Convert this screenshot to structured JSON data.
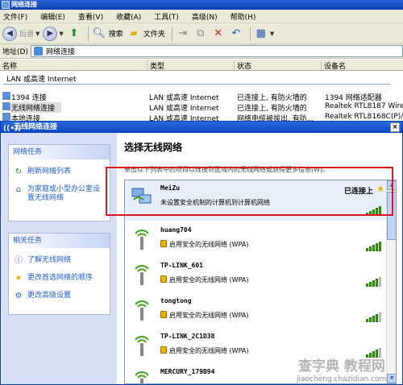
{
  "window": {
    "title": "网络连接"
  },
  "menubar": [
    "文件(F)",
    "编辑(E)",
    "查看(V)",
    "收藏(A)",
    "工具(T)",
    "高级(N)",
    "帮助(H)"
  ],
  "toolbar": {
    "back": "后退",
    "search": "搜索",
    "folders": "文件夹"
  },
  "address": {
    "label": "地址(D)",
    "value": "网络连接"
  },
  "columns": {
    "name": "名称",
    "type": "类型",
    "status": "状态",
    "device": "设备名"
  },
  "group_title": "LAN 或高速 Internet",
  "connections": [
    {
      "name": "1394 连接",
      "type": "LAN 或高速 Internet",
      "status": "已连接上, 有防火墙的",
      "device": "1394 网络适配器"
    },
    {
      "name": "无线网络连接",
      "type": "LAN 或高速 Internet",
      "status": "已连接上, 有防火墙的",
      "device": "Realtek RTL8187 Wireles..."
    },
    {
      "name": "本地连接",
      "type": "LAN 或高速 Internet",
      "status": "网络电缆被拔出, 有防...",
      "device": "Realtek RTL8168C(P)/81..."
    }
  ],
  "dialog": {
    "title": "无线网络连接",
    "close": "×",
    "heading": "选择无线网络",
    "description": "单击以下列表中的项目以连接到区域内的无线网络或获得更多信息(W)。"
  },
  "sidebar": {
    "net_tasks": {
      "header": "网络任务",
      "items": [
        "刷新网络列表",
        "为家庭或小型办公室设置无线网络"
      ]
    },
    "related_tasks": {
      "header": "相关任务",
      "items": [
        "了解无线网络",
        "更改首选网络的顺序",
        "更改高级设置"
      ]
    }
  },
  "networks": [
    {
      "ssid": "MeiZu",
      "status": "未设置安全机制的计算机到计算机网络",
      "connected_label": "已连接上",
      "secure": false,
      "signal": 5
    },
    {
      "ssid": "huang704",
      "status": "启用安全的无线网络 (WPA)",
      "secure": true,
      "signal": 5
    },
    {
      "ssid": "TP-LINK_601",
      "status": "启用安全的无线网络 (WPA)",
      "secure": true,
      "signal": 4
    },
    {
      "ssid": "tongtong",
      "status": "启用安全的无线网络 (WPA)",
      "secure": true,
      "signal": 4
    },
    {
      "ssid": "TP-LINK_2C1D38",
      "status": "启用安全的无线网络 (WPA)",
      "secure": true,
      "signal": 4
    },
    {
      "ssid": "MERCURY_179B94",
      "status": "",
      "secure": true,
      "signal": 3
    }
  ],
  "watermark": {
    "line1": "查字典 教程网",
    "line2": "jiaocheng.chazidian.com"
  },
  "colors": {
    "title_blue": "#0a3fb0",
    "link_blue": "#215dc6",
    "highlight_red": "#e0141b",
    "signal_green": "#3ca40c"
  }
}
